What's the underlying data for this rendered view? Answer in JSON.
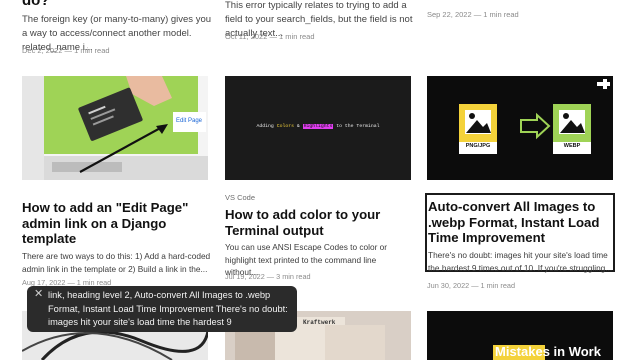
{
  "top_row": {
    "col1_title": "do?",
    "col1_excerpt": "The foreign key (or many-to-many) gives you a way to access/connect another model. related_name i...",
    "col1_meta": "Dec 2, 2022 — 1 min read",
    "col2_excerpt": "This error typically relates to trying to add a field to your search_fields, but the field is not actually text...",
    "col2_meta": "Oct 11, 2022 — 1 min read",
    "col3_meta": "Sep 22, 2022 — 1 min read"
  },
  "cards": [
    {
      "tag": "",
      "title": "How to add an \"Edit Page\" admin link on a Django template",
      "excerpt": "There are two ways to do this: 1) Add a hard-coded admin link in the template or 2) Build a link in the...",
      "meta": "Aug 17, 2022 — 1 min read",
      "thumb_label": "Edit Page"
    },
    {
      "tag": "VS Code",
      "title": "How to add color to your Terminal output",
      "excerpt": "You can use ANSI Escape Codes to color or highlight text printed to the command line without...",
      "meta": "Jul 19, 2022 — 3 min read",
      "thumb_text_a": "Adding ",
      "thumb_text_b": "Colors",
      "thumb_text_c": " & ",
      "thumb_text_d": "Highlights",
      "thumb_text_e": " to the Terminal"
    },
    {
      "tag": "",
      "title": "Auto-convert All Images to .webp Format, Instant Load Time Improvement",
      "excerpt": "There's no doubt: images hit your site's load time the hardest 9 times out of 10. If you're struggling...",
      "meta": "Jun 30, 2022 — 1 min read",
      "thumb_left_label": "PNG/JPG",
      "thumb_right_label": "WEBP"
    }
  ],
  "bottom": {
    "tile2_text": "Kraftwerk",
    "tile3_text": "Mistakes in Work"
  },
  "tooltip": {
    "close": "✕",
    "text": "link, heading level 2, Auto-convert All Images to .webp Format, Instant Load Time Improvement There's no doubt: images hit your site's load time the hardest 9"
  },
  "colors": {
    "green": "#9fd356",
    "yellow": "#f4d23a",
    "magenta": "#e03df0",
    "focus": "#1b1b1b"
  }
}
